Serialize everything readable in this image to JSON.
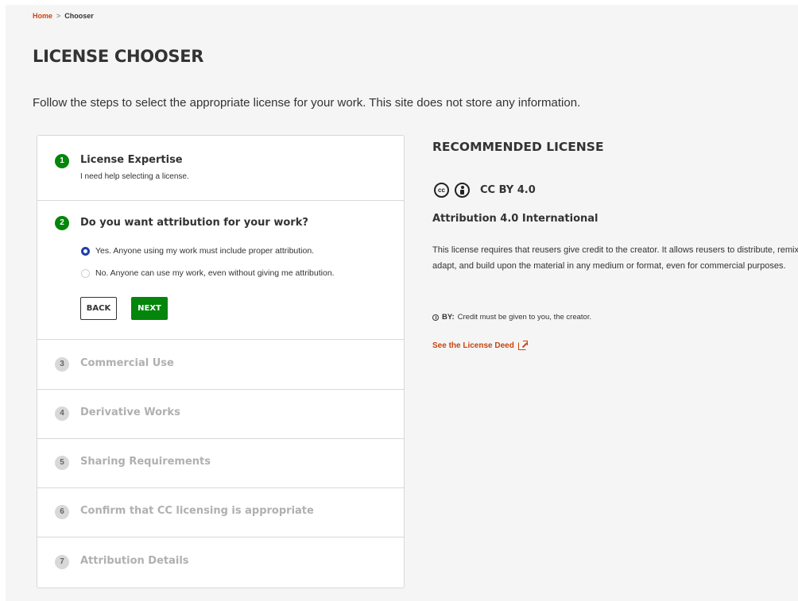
{
  "breadcrumb": {
    "home": "Home",
    "separator": ">",
    "current": "Chooser"
  },
  "page": {
    "title": "LICENSE CHOOSER",
    "intro": "Follow the steps to select the appropriate license for your work. This site does not store any information."
  },
  "steps": [
    {
      "number": "1",
      "title": "License Expertise",
      "subtitle": "I need help selecting a license.",
      "state": "completed"
    },
    {
      "number": "2",
      "title": "Do you want attribution for your work?",
      "state": "active",
      "options": [
        {
          "label": "Yes. Anyone using my work must include proper attribution.",
          "selected": true
        },
        {
          "label": "No. Anyone can use my work, even without giving me attribution.",
          "selected": false
        }
      ],
      "back_label": "BACK",
      "next_label": "NEXT"
    },
    {
      "number": "3",
      "title": "Commercial Use",
      "state": "pending"
    },
    {
      "number": "4",
      "title": "Derivative Works",
      "state": "pending"
    },
    {
      "number": "5",
      "title": "Sharing Requirements",
      "state": "pending"
    },
    {
      "number": "6",
      "title": "Confirm that CC licensing is appropriate",
      "state": "pending"
    },
    {
      "number": "7",
      "title": "Attribution Details",
      "state": "pending"
    }
  ],
  "recommended": {
    "heading": "RECOMMENDED LICENSE",
    "cc_icon_text": "cc",
    "icons": [
      "cc-icon",
      "by-icon"
    ],
    "code": "CC BY 4.0",
    "name": "Attribution 4.0 International",
    "description": "This license requires that reusers give credit to the creator. It allows reusers to distribute, remix, adapt, and build upon the material in any medium or format, even for commercial purposes.",
    "by_label": "BY:",
    "by_text": "Credit must be given to you, the creator.",
    "deed_link": "See the License Deed"
  },
  "colors": {
    "accent_green": "#04850b",
    "link_orange": "#c9440e",
    "radio_blue": "#1d3fa8",
    "inactive_text": "#b0b0b0"
  }
}
